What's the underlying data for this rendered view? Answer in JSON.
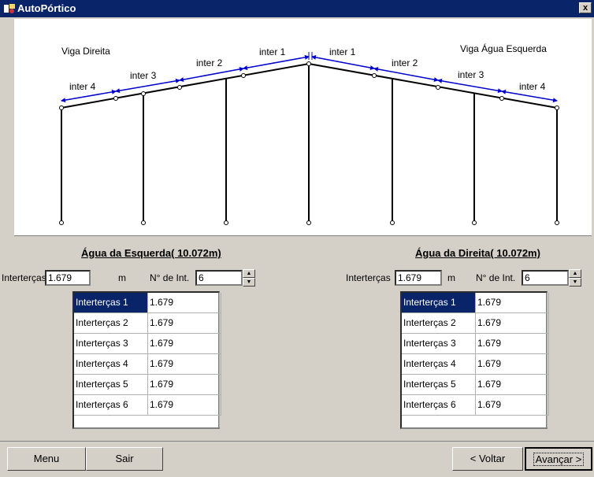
{
  "window": {
    "title": "AutoPórtico",
    "close_label": "x"
  },
  "diagram": {
    "label_left_beam": "Viga Direita",
    "label_right_beam": "Viga Água Esquerda",
    "left_spans": [
      "inter 4",
      "inter 3",
      "inter 2",
      "inter 1"
    ],
    "right_spans": [
      "inter 1",
      "inter 2",
      "inter 3",
      "inter 4"
    ]
  },
  "left": {
    "title": "Água da Esquerda( 10.072m)",
    "interspacing_label": "Interterças",
    "interspacing_value": "1.679",
    "unit": "m",
    "count_label": "N° de Int.",
    "count_value": "6",
    "rows": [
      {
        "name": "Interterças 1",
        "value": "1.679"
      },
      {
        "name": "Interterças 2",
        "value": "1.679"
      },
      {
        "name": "Interterças 3",
        "value": "1.679"
      },
      {
        "name": "Interterças 4",
        "value": "1.679"
      },
      {
        "name": "Interterças 5",
        "value": "1.679"
      },
      {
        "name": "Interterças 6",
        "value": "1.679"
      }
    ]
  },
  "right": {
    "title": "Água da Direita( 10.072m)",
    "interspacing_label": "Interterças",
    "interspacing_value": "1.679",
    "unit": "m",
    "count_label": "N° de Int.",
    "count_value": "6",
    "rows": [
      {
        "name": "Interterças 1",
        "value": "1.679"
      },
      {
        "name": "Interterças 2",
        "value": "1.679"
      },
      {
        "name": "Interterças 3",
        "value": "1.679"
      },
      {
        "name": "Interterças 4",
        "value": "1.679"
      },
      {
        "name": "Interterças 5",
        "value": "1.679"
      },
      {
        "name": "Interterças 6",
        "value": "1.679"
      }
    ]
  },
  "buttons": {
    "menu": "Menu",
    "exit": "Sair",
    "back": "< Voltar",
    "next": "Avançar >"
  },
  "colors": {
    "titlebar": "#0a246a",
    "dimension_arrows": "#0000cc",
    "selection": "#0a246a"
  }
}
